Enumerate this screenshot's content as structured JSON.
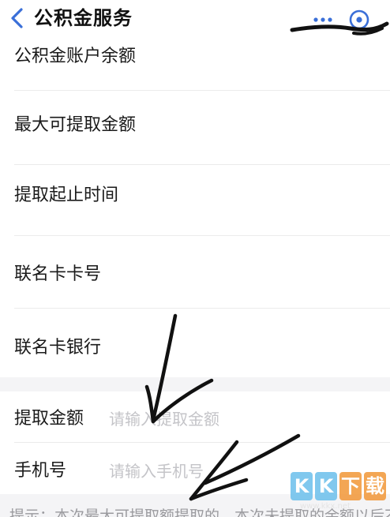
{
  "header": {
    "title": "公积金服务",
    "back_icon": "chevron-left-icon",
    "more_icon": "more-dots-icon",
    "close_icon": "capsule-close-icon",
    "accent_color": "#3a6fd8"
  },
  "info_rows": [
    {
      "label": "公积金账户余额"
    },
    {
      "label": "最大可提取金额"
    },
    {
      "label": "提取起止时间"
    },
    {
      "label": "联名卡卡号"
    },
    {
      "label": "联名卡银行"
    }
  ],
  "form": {
    "amount": {
      "label": "提取金额",
      "placeholder": "请输入提取金额",
      "value": ""
    },
    "phone": {
      "label": "手机号",
      "placeholder": "请输入手机号",
      "value": ""
    }
  },
  "tip": {
    "text": "提示：本次最大可提取额提取的，本次未提取的余额以后不能"
  },
  "watermark": {
    "letters": [
      "K",
      "K",
      "下",
      "载"
    ],
    "url": "www.kkx.net"
  },
  "colors": {
    "separator": "#f4f4f6",
    "placeholder": "#c4c4c8",
    "tip_text": "#9a9a9e"
  }
}
